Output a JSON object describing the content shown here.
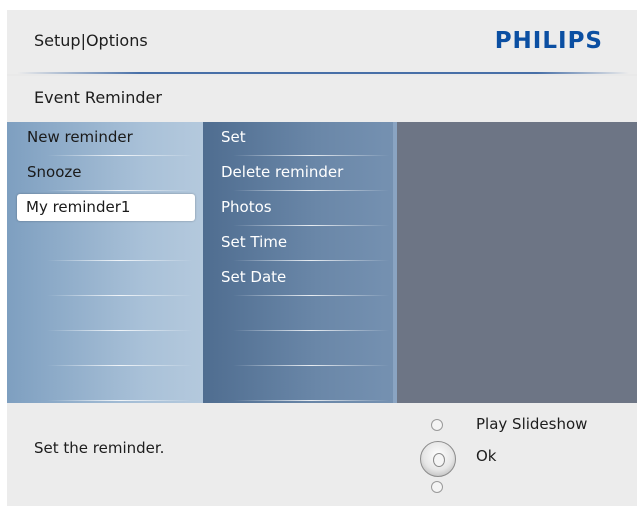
{
  "header": {
    "title": "Setup|Options",
    "brand": "PHILIPS"
  },
  "section": {
    "label": "Event Reminder"
  },
  "menu": {
    "col1": [
      "New reminder",
      "Snooze",
      "My reminder1"
    ],
    "col1_selected": "My reminder1",
    "col2": [
      "Set",
      "Delete reminder",
      "Photos",
      "Set Time",
      "Set Date"
    ]
  },
  "footer": {
    "description": "Set the reminder.",
    "hint_up": "Play Slideshow",
    "hint_ok": "Ok"
  },
  "colors": {
    "brand": "#0b4fa2",
    "panel_left": "#a9c1d8",
    "panel_mid": "#5f7c9f",
    "panel_right": "#6d7585"
  }
}
